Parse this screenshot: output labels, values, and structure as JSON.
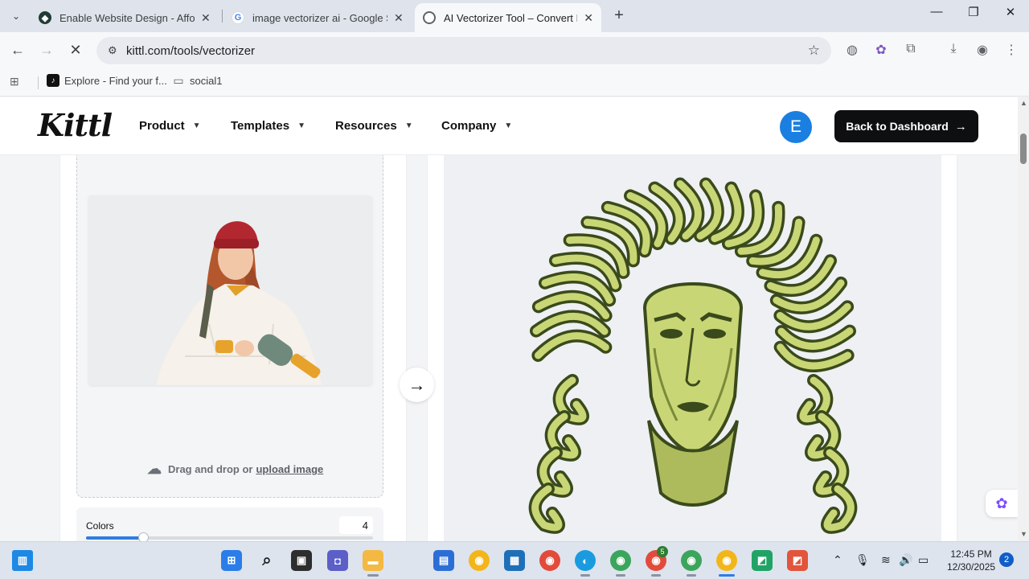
{
  "browser": {
    "tabs": [
      {
        "title": "Enable Website Design - Afford",
        "active": false
      },
      {
        "title": "image vectorizer ai - Google Se",
        "active": false
      },
      {
        "title": "AI Vectorizer Tool – Convert Im",
        "active": true
      }
    ],
    "address": "kittl.com/tools/vectorizer",
    "bookmarks": [
      {
        "label": "Explore - Find your f..."
      },
      {
        "label": "social1"
      }
    ]
  },
  "site": {
    "logo": "Kittl",
    "nav": [
      {
        "label": "Product"
      },
      {
        "label": "Templates"
      },
      {
        "label": "Resources"
      },
      {
        "label": "Company"
      }
    ],
    "avatar_initial": "E",
    "dashboard_button": "Back to Dashboard"
  },
  "upload": {
    "text": "Drag and drop or",
    "link": "upload image"
  },
  "settings": {
    "colors_label": "Colors",
    "colors_value": "4",
    "colors_slider_fraction": 0.2
  },
  "taskbar": {
    "time": "12:45 PM",
    "date": "12/30/2025",
    "notifications": "2",
    "badge_count": "5"
  },
  "colors": {
    "accent": "#1a7fe0",
    "dashboard_button_bg": "#0e0f11",
    "vector_dark": "#3a4a1c",
    "vector_light": "#c9d675"
  }
}
